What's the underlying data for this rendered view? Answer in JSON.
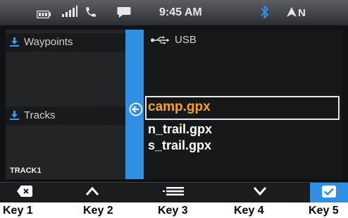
{
  "status": {
    "time": "9:45 AM",
    "heading": "N",
    "icons": [
      "battery-icon",
      "signal-icon",
      "phone-icon",
      "message-icon",
      "bluetooth-icon",
      "compass-arrow-icon"
    ]
  },
  "left_panel": {
    "waypoints_label": "Waypoints",
    "tracks_label": "Tracks",
    "footer_label": "TRACK1"
  },
  "right_panel": {
    "source_label": "USB",
    "files": [
      "camp.gpx",
      "n_trail.gpx",
      "s_trail.gpx"
    ],
    "selected_index": 0
  },
  "softkeys": [
    {
      "icon": "delete-icon"
    },
    {
      "icon": "chevron-up-icon"
    },
    {
      "icon": "menu-icon"
    },
    {
      "icon": "chevron-down-icon"
    },
    {
      "icon": "check-icon",
      "active": true
    }
  ],
  "key_labels": [
    "Key 1",
    "Key 2",
    "Key 3",
    "Key 4",
    "Key 5"
  ],
  "colors": {
    "accent_blue": "#2f8fe3",
    "selected_text": "#f3a421",
    "background": "#202226"
  }
}
